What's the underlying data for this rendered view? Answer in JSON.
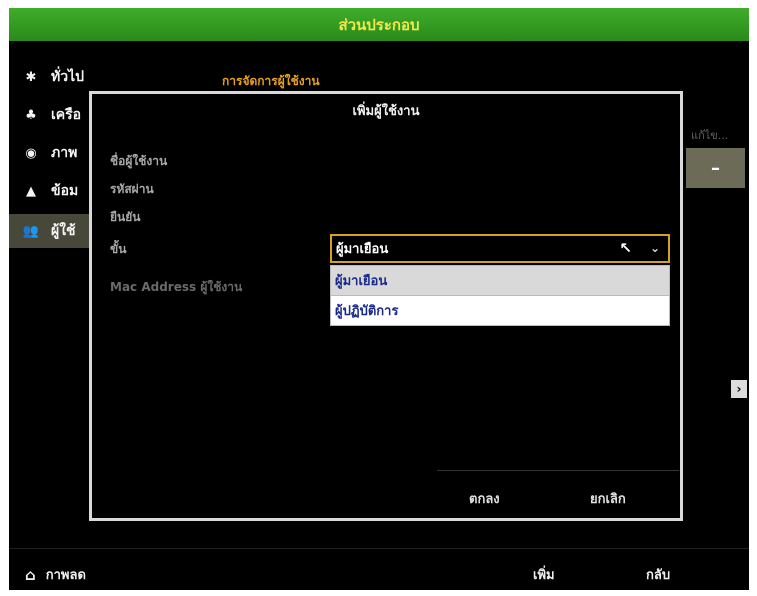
{
  "window": {
    "title": "ส่วนประกอบ"
  },
  "sidebar": {
    "items": [
      {
        "label": "ทั่วไป",
        "icon": "gear-icon"
      },
      {
        "label": "เครือ",
        "icon": "network-icon"
      },
      {
        "label": "ภาพ",
        "icon": "eye-icon"
      },
      {
        "label": "ข้อม",
        "icon": "warning-icon"
      },
      {
        "label": "ผู้ใช้",
        "icon": "users-icon"
      }
    ]
  },
  "main": {
    "section_title": "การจัดการผู้ใช้งาน",
    "right_column_text": "แก้ไข...",
    "right_button_label": "–",
    "scroll_arrow": "›"
  },
  "dialog": {
    "title": "เพิ่มผู้ใช้งาน",
    "fields": {
      "username_label": "ชื่อผู้ใช้งาน",
      "password_label": "รหัสผ่าน",
      "confirm_label": "ยืนยัน",
      "level_label": "ขั้น",
      "mac_label": "Mac Address ผู้ใช้งาน"
    },
    "level_select": {
      "value": "ผู้มาเยือน",
      "options": [
        "ผู้มาเยือน",
        "ผู้ปฏิบัติการ"
      ]
    },
    "ok_label": "ตกลง",
    "cancel_label": "ยกเลิก"
  },
  "bottom": {
    "home_label": "กาพลด",
    "add_label": "เพิ่ม",
    "back_label": "กลับ"
  },
  "colors": {
    "titlebar_green": "#3fae2a",
    "title_text_yellow": "#f2e84a",
    "section_orange": "#e6a020",
    "select_border": "#d6a020"
  }
}
